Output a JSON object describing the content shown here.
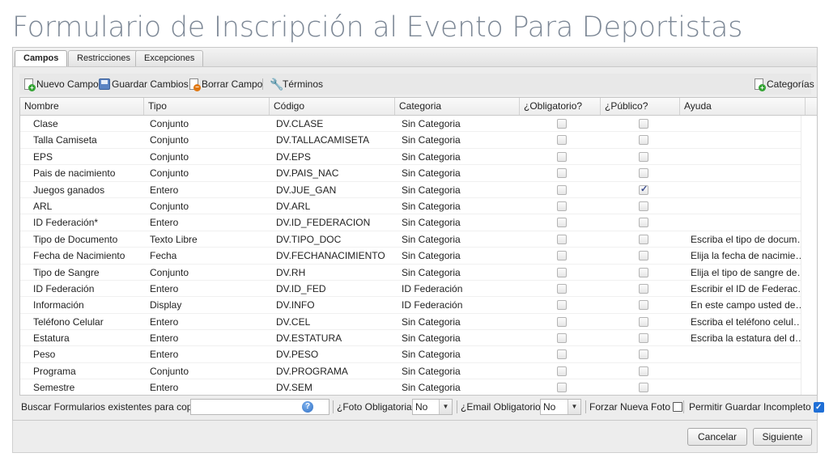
{
  "page": {
    "title": "Formulario de Inscripción al Evento Para Deportistas"
  },
  "tabs": [
    {
      "label": "Campos",
      "active": true
    },
    {
      "label": "Restricciones",
      "active": false
    },
    {
      "label": "Excepciones",
      "active": false
    }
  ],
  "toolbar": {
    "new_field": "Nuevo Campo",
    "save_changes": "Guardar Cambios",
    "delete_field": "Borrar Campo",
    "terms": "Términos",
    "categories": "Categorías"
  },
  "grid": {
    "columns": [
      "Nombre",
      "Tipo",
      "Código",
      "Categoria",
      "¿Obligatorio?",
      "¿Público?",
      "Ayuda"
    ],
    "rows": [
      {
        "nombre": "Clase",
        "tipo": "Conjunto",
        "codigo": "DV.CLASE",
        "categoria": "Sin Categoria",
        "obligatorio": false,
        "publico": false,
        "ayuda": ""
      },
      {
        "nombre": "Talla Camiseta",
        "tipo": "Conjunto",
        "codigo": "DV.TALLACAMISETA",
        "categoria": "Sin Categoria",
        "obligatorio": false,
        "publico": false,
        "ayuda": ""
      },
      {
        "nombre": "EPS",
        "tipo": "Conjunto",
        "codigo": "DV.EPS",
        "categoria": "Sin Categoria",
        "obligatorio": false,
        "publico": false,
        "ayuda": ""
      },
      {
        "nombre": "Pais de nacimiento",
        "tipo": "Conjunto",
        "codigo": "DV.PAIS_NAC",
        "categoria": "Sin Categoria",
        "obligatorio": false,
        "publico": false,
        "ayuda": ""
      },
      {
        "nombre": "Juegos ganados",
        "tipo": "Entero",
        "codigo": "DV.JUE_GAN",
        "categoria": "Sin Categoria",
        "obligatorio": false,
        "publico": true,
        "ayuda": ""
      },
      {
        "nombre": "ARL",
        "tipo": "Conjunto",
        "codigo": "DV.ARL",
        "categoria": "Sin Categoria",
        "obligatorio": false,
        "publico": false,
        "ayuda": ""
      },
      {
        "nombre": "ID Federación*",
        "tipo": "Entero",
        "codigo": "DV.ID_FEDERACION",
        "categoria": "Sin Categoria",
        "obligatorio": false,
        "publico": false,
        "ayuda": ""
      },
      {
        "nombre": "Tipo de Documento",
        "tipo": "Texto Libre",
        "codigo": "DV.TIPO_DOC",
        "categoria": "Sin Categoria",
        "obligatorio": false,
        "publico": false,
        "ayuda": "Escriba el tipo de documen…"
      },
      {
        "nombre": "Fecha de Nacimiento",
        "tipo": "Fecha",
        "codigo": "DV.FECHANACIMIENTO",
        "categoria": "Sin Categoria",
        "obligatorio": false,
        "publico": false,
        "ayuda": "Elija la fecha de nacimiento…"
      },
      {
        "nombre": "Tipo de Sangre",
        "tipo": "Conjunto",
        "codigo": "DV.RH",
        "categoria": "Sin Categoria",
        "obligatorio": false,
        "publico": false,
        "ayuda": "Elija el tipo de sangre del d…"
      },
      {
        "nombre": "ID Federación",
        "tipo": "Entero",
        "codigo": "DV.ID_FED",
        "categoria": "ID Federación",
        "obligatorio": false,
        "publico": false,
        "ayuda": "Escribir el ID de Federació…"
      },
      {
        "nombre": "Información",
        "tipo": "Display",
        "codigo": "DV.INFO",
        "categoria": "ID Federación",
        "obligatorio": false,
        "publico": false,
        "ayuda": "En este campo usted debe …"
      },
      {
        "nombre": "Teléfono Celular",
        "tipo": "Entero",
        "codigo": "DV.CEL",
        "categoria": "Sin Categoria",
        "obligatorio": false,
        "publico": false,
        "ayuda": "Escriba el teléfono celular …"
      },
      {
        "nombre": "Estatura",
        "tipo": "Entero",
        "codigo": "DV.ESTATURA",
        "categoria": "Sin Categoria",
        "obligatorio": false,
        "publico": false,
        "ayuda": "Escriba la estatura del dep…"
      },
      {
        "nombre": "Peso",
        "tipo": "Entero",
        "codigo": "DV.PESO",
        "categoria": "Sin Categoria",
        "obligatorio": false,
        "publico": false,
        "ayuda": ""
      },
      {
        "nombre": "Programa",
        "tipo": "Conjunto",
        "codigo": "DV.PROGRAMA",
        "categoria": "Sin Categoria",
        "obligatorio": false,
        "publico": false,
        "ayuda": ""
      },
      {
        "nombre": "Semestre",
        "tipo": "Entero",
        "codigo": "DV.SEM",
        "categoria": "Sin Categoria",
        "obligatorio": false,
        "publico": false,
        "ayuda": ""
      }
    ]
  },
  "bottom": {
    "search_label": "Buscar Formularios existentes para copiar:",
    "search_value": "",
    "photo_required_label": "¿Foto Obligatoria?",
    "photo_required_value": "No",
    "email_required_label": "¿Email Obligatorio?",
    "email_required_value": "No",
    "force_new_photo_label": "Forzar Nueva Foto",
    "force_new_photo_checked": false,
    "allow_incomplete_label": "Permitir Guardar Incompleto",
    "allow_incomplete_checked": true
  },
  "footer": {
    "cancel": "Cancelar",
    "next": "Siguiente"
  }
}
